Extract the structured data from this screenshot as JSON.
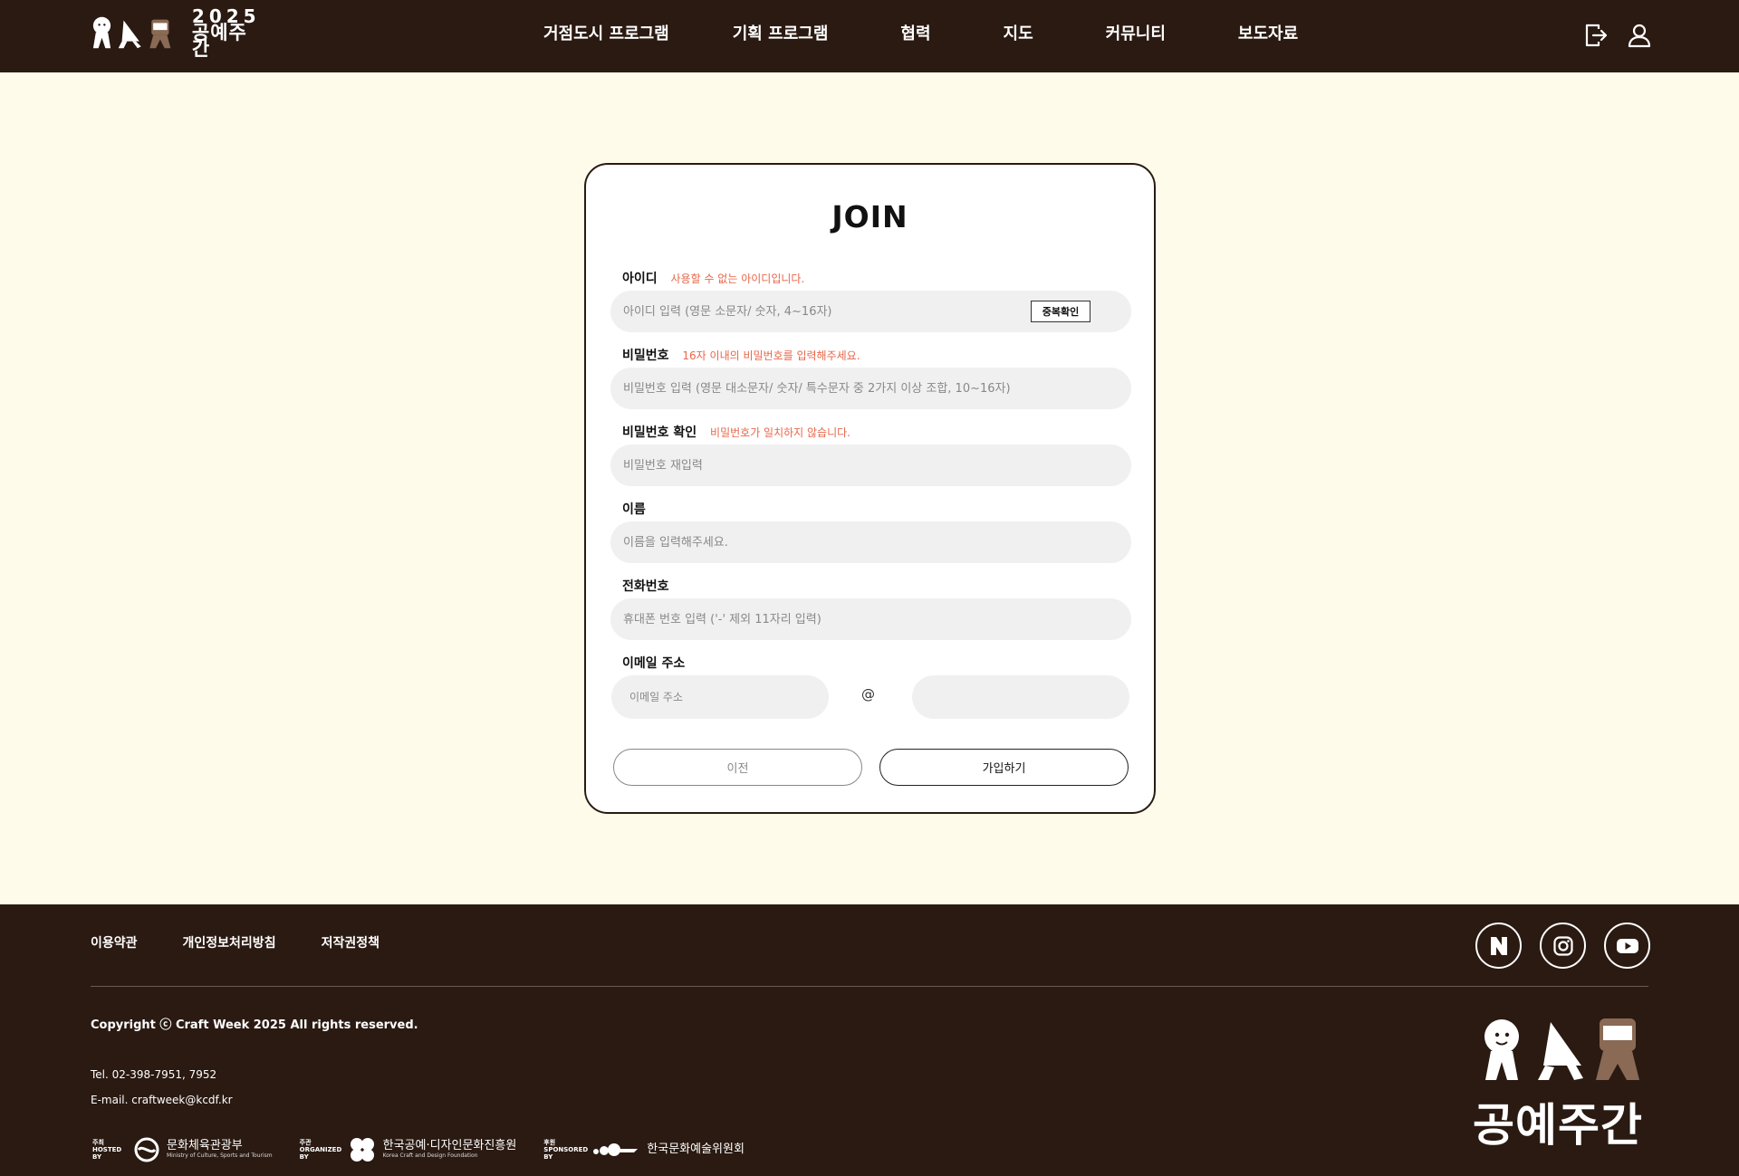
{
  "header": {
    "logo": {
      "year": "2025",
      "name": "공예주간"
    },
    "nav": [
      {
        "label": "거점도시 프로그램"
      },
      {
        "label": "기획 프로그램"
      },
      {
        "label": "협력"
      },
      {
        "label": "지도"
      },
      {
        "label": "커뮤니티"
      },
      {
        "label": "보도자료"
      }
    ],
    "icons": [
      "logout-icon",
      "user-icon"
    ]
  },
  "form": {
    "title": "JOIN",
    "id": {
      "label": "아이디",
      "message": "사용할 수 없는 아이디입니다.",
      "placeholder": "아이디 입력 (영문 소문자/ 숫자, 4~16자)",
      "check_button": "중복확인"
    },
    "password": {
      "label": "비밀번호",
      "message": "16자 이내의 비밀번호를 입력해주세요.",
      "placeholder": "비밀번호 입력 (영문 대소문자/ 숫자/ 특수문자 중 2가지 이상 조합, 10~16자)"
    },
    "password_confirm": {
      "label": "비밀번호 확인",
      "message": "비밀번호가 일치하지 않습니다.",
      "placeholder": "비밀번호 재입력"
    },
    "name": {
      "label": "이름",
      "placeholder": "이름을 입력해주세요."
    },
    "phone": {
      "label": "전화번호",
      "placeholder": "휴대폰 번호 입력 ('-' 제외 11자리 입력)"
    },
    "email": {
      "label": "이메일 주소",
      "local_placeholder": "이메일 주소",
      "at": "@",
      "domain_placeholder": ""
    },
    "prev_button": "이전",
    "submit_button": "가입하기"
  },
  "footer": {
    "links": [
      {
        "label": "이용약관"
      },
      {
        "label": "개인정보처리방침"
      },
      {
        "label": "저작권정책"
      }
    ],
    "social": [
      "naver-icon",
      "instagram-icon",
      "youtube-icon"
    ],
    "copyright": "Copyright ⓒ Craft Week 2025 All rights reserved.",
    "tel": "Tel. 02-398-7951, 7952",
    "email": "E-mail. craftweek@kcdf.kr",
    "partners": {
      "hosted": {
        "tag": "주최 HOSTED BY",
        "name": "문화체육관광부",
        "sub": "Ministry of Culture, Sports and Tourism"
      },
      "organized": {
        "tag": "주관 ORGANIZED BY",
        "name": "한국공예·디자인문화진흥원",
        "sub": "Korea Craft and Design Foundation"
      },
      "sponsored": {
        "tag": "후원 SPONSORED BY",
        "name": "한국문화예술위원회"
      }
    },
    "logo_name": "공예주간"
  },
  "colors": {
    "header_bg": "#2a1a12",
    "page_bg": "#fffbea",
    "error": "#e8674a",
    "input_bg": "#f0f0f0"
  }
}
